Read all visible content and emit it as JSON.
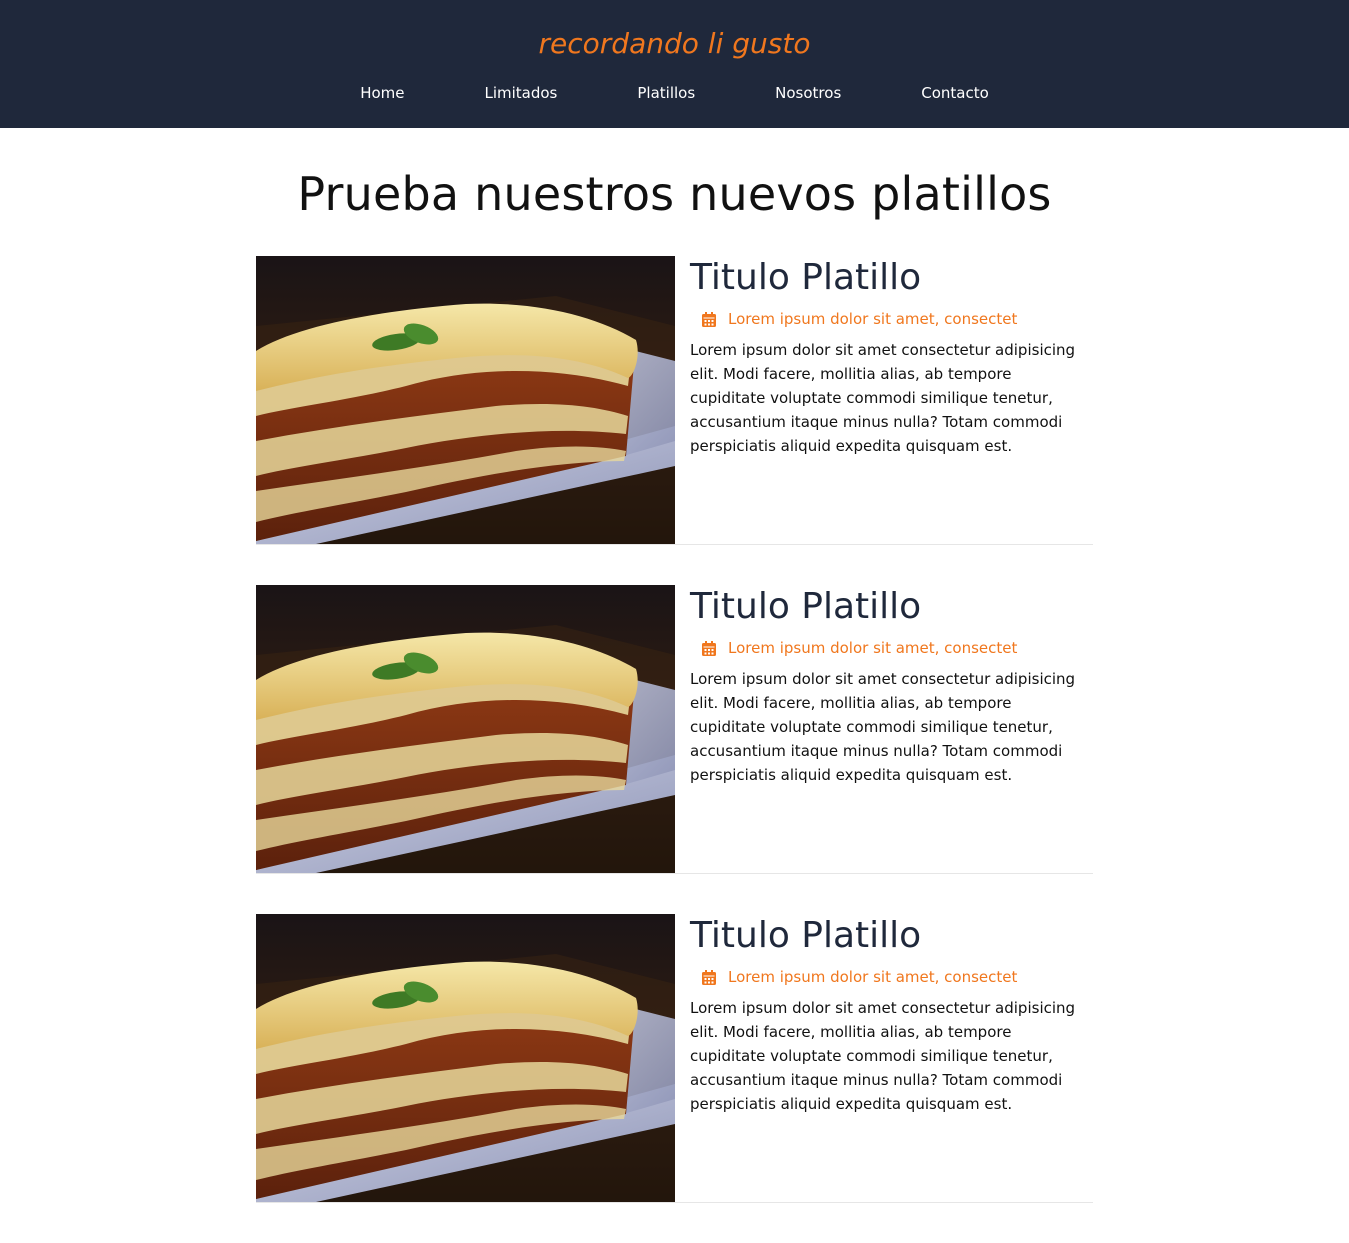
{
  "header": {
    "brand": "recordando li gusto",
    "nav": [
      "Home",
      "Limitados",
      "Platillos",
      "Nosotros",
      "Contacto"
    ]
  },
  "main": {
    "title": "Prueba nuestros nuevos platillos",
    "cards": [
      {
        "title": "Titulo Platillo",
        "meta": "Lorem ipsum dolor sit amet, consectet",
        "text": "Lorem ipsum dolor sit amet consectetur adipisicing elit. Modi facere, mollitia alias, ab tempore cupiditate voluptate commodi similique tenetur, accusantium itaque minus nulla? Totam commodi perspiciatis aliquid expedita quisquam est."
      },
      {
        "title": "Titulo Platillo",
        "meta": "Lorem ipsum dolor sit amet, consectet",
        "text": "Lorem ipsum dolor sit amet consectetur adipisicing elit. Modi facere, mollitia alias, ab tempore cupiditate voluptate commodi similique tenetur, accusantium itaque minus nulla? Totam commodi perspiciatis aliquid expedita quisquam est."
      },
      {
        "title": "Titulo Platillo",
        "meta": "Lorem ipsum dolor sit amet, consectet",
        "text": "Lorem ipsum dolor sit amet consectetur adipisicing elit. Modi facere, mollitia alias, ab tempore cupiditate voluptate commodi similique tenetur, accusantium itaque minus nulla? Totam commodi perspiciatis aliquid expedita quisquam est."
      }
    ]
  },
  "icons": {
    "meta_icon": "calendar-icon"
  },
  "colors": {
    "header_bg": "#1f283b",
    "accent": "#f0771e",
    "card_title": "#1f283b"
  }
}
